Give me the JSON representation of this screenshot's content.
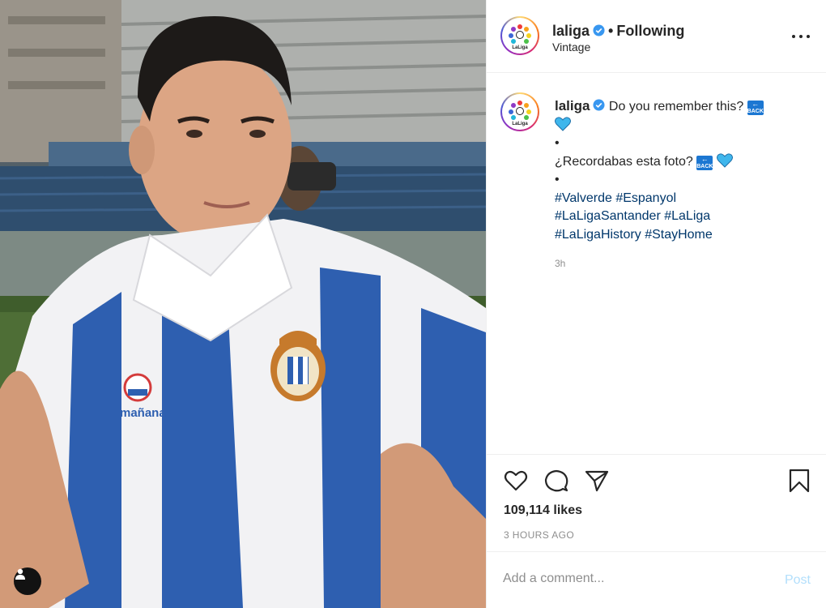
{
  "post": {
    "image_alt": "Vintage photo of Valverde in Espanyol kit",
    "sponsor_text": "mañana",
    "crest_text": "CLUB DEPORTIVO ESPAÑOL · REAL"
  },
  "header": {
    "username": "laliga",
    "separator": "•",
    "follow_status": "Following",
    "location": "Vintage",
    "avatar_text": "LaLiga"
  },
  "caption": {
    "username": "laliga",
    "line1": "Do you remember this?",
    "bullet": "•",
    "line2": "¿Recordabas esta foto?",
    "back_emoji": "BACK",
    "hashtags_line1": [
      "#Valverde",
      "#Espanyol"
    ],
    "hashtags_line2": [
      "#LaLigaSantander",
      "#LaLiga"
    ],
    "hashtags_line3": [
      "#LaLigaHistory",
      "#StayHome"
    ],
    "time": "3h"
  },
  "actions": {
    "icons": [
      "heart-icon",
      "comment-icon",
      "share-icon",
      "bookmark-icon"
    ],
    "likes": "109,114 likes",
    "timestamp": "3 HOURS AGO"
  },
  "comment": {
    "placeholder": "Add a comment...",
    "post_label": "Post"
  },
  "colors": {
    "hashtag": "#00376b",
    "muted": "#8e8e8e",
    "verified": "#3897f0",
    "post_disabled": "#b2dffc",
    "kit_blue": "#2e5fb0"
  }
}
